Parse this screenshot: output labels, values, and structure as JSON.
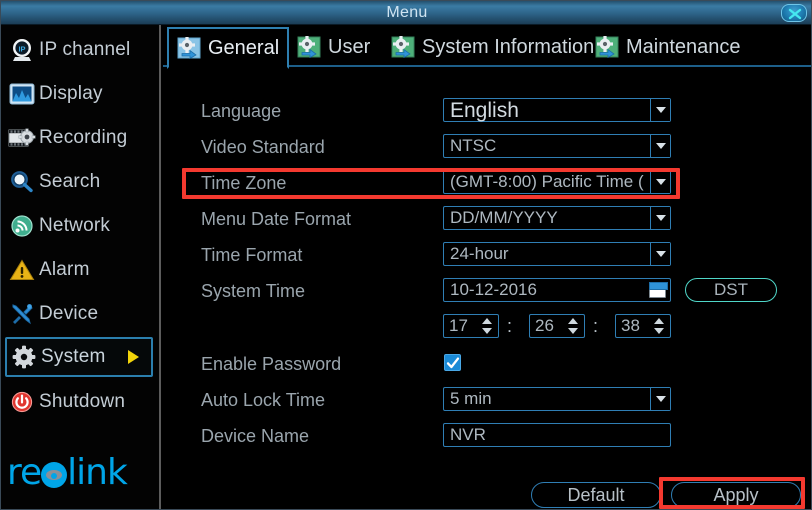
{
  "window": {
    "title": "Menu",
    "close_icon": "close-x-icon",
    "accent": "#2f7eb4",
    "highlight": "#f4392f"
  },
  "sidebar": {
    "brand": "reolink",
    "items": [
      {
        "label": "IP channel",
        "icon": "ip-camera-icon",
        "selected": false
      },
      {
        "label": "Display",
        "icon": "display-icon",
        "selected": false
      },
      {
        "label": "Recording",
        "icon": "recording-icon",
        "selected": false
      },
      {
        "label": "Search",
        "icon": "magnifier-icon",
        "selected": false
      },
      {
        "label": "Network",
        "icon": "wifi-icon",
        "selected": false
      },
      {
        "label": "Alarm",
        "icon": "warning-triangle-icon",
        "selected": false
      },
      {
        "label": "Device",
        "icon": "tools-icon",
        "selected": false
      },
      {
        "label": "System",
        "icon": "gear-icon",
        "selected": true
      },
      {
        "label": "Shutdown",
        "icon": "power-icon",
        "selected": false
      }
    ]
  },
  "tabs": [
    {
      "label": "General",
      "icon": "gear-arrow-icon",
      "active": true
    },
    {
      "label": "User",
      "icon": "gear-arrow-icon",
      "active": false
    },
    {
      "label": "System Information",
      "icon": "gear-arrow-icon",
      "active": false
    },
    {
      "label": "Maintenance",
      "icon": "gear-arrow-icon",
      "active": false
    }
  ],
  "form": {
    "language": {
      "label": "Language",
      "value": "English"
    },
    "video_standard": {
      "label": "Video Standard",
      "value": "NTSC"
    },
    "time_zone": {
      "label": "Time Zone",
      "value": "(GMT-8:00) Pacific Time ("
    },
    "menu_date_format": {
      "label": "Menu Date Format",
      "value": "DD/MM/YYYY"
    },
    "time_format": {
      "label": "Time Format",
      "value": "24-hour"
    },
    "system_time": {
      "label": "System Time",
      "value": "10-12-2016",
      "calendar_icon": "calendar-icon"
    },
    "dst": {
      "label": "DST"
    },
    "clock": {
      "hours": "17",
      "minutes": "26",
      "seconds": "38",
      "sep": ":"
    },
    "enable_password": {
      "label": "Enable Password",
      "checked": true
    },
    "auto_lock_time": {
      "label": "Auto Lock Time",
      "value": "5 min"
    },
    "device_name": {
      "label": "Device Name",
      "value": "NVR"
    }
  },
  "footer": {
    "default_label": "Default",
    "apply_label": "Apply"
  },
  "annotations": {
    "timezone_highlight": "red-box-time-zone",
    "apply_highlight": "red-box-apply"
  }
}
